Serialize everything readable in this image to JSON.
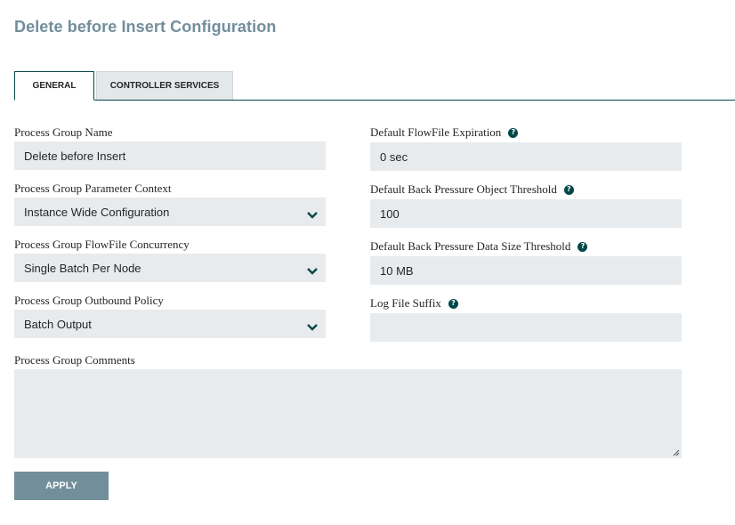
{
  "page": {
    "title": "Delete before Insert Configuration"
  },
  "tabs": [
    {
      "label": "GENERAL",
      "active": true
    },
    {
      "label": "CONTROLLER SERVICES",
      "active": false
    }
  ],
  "left": {
    "name": {
      "label": "Process Group Name",
      "value": "Delete before Insert"
    },
    "parameter_context": {
      "label": "Process Group Parameter Context",
      "value": "Instance Wide Configuration"
    },
    "concurrency": {
      "label": "Process Group FlowFile Concurrency",
      "value": "Single Batch Per Node"
    },
    "outbound_policy": {
      "label": "Process Group Outbound Policy",
      "value": "Batch Output"
    },
    "comments": {
      "label": "Process Group Comments",
      "value": ""
    }
  },
  "right": {
    "expiration": {
      "label": "Default FlowFile Expiration",
      "value": "0 sec"
    },
    "object_threshold": {
      "label": "Default Back Pressure Object Threshold",
      "value": "100"
    },
    "data_size_threshold": {
      "label": "Default Back Pressure Data Size Threshold",
      "value": "10 MB"
    },
    "log_suffix": {
      "label": "Log File Suffix",
      "value": ""
    }
  },
  "help_icon_glyph": "?",
  "icons": {
    "help": "question-circle-icon",
    "dropdown": "chevron-down-icon"
  },
  "colors": {
    "accent": "#004849",
    "title": "#728e9b",
    "field_bg": "#e8ebed",
    "button_bg": "#728e9b"
  },
  "apply_button": {
    "label": "APPLY"
  }
}
